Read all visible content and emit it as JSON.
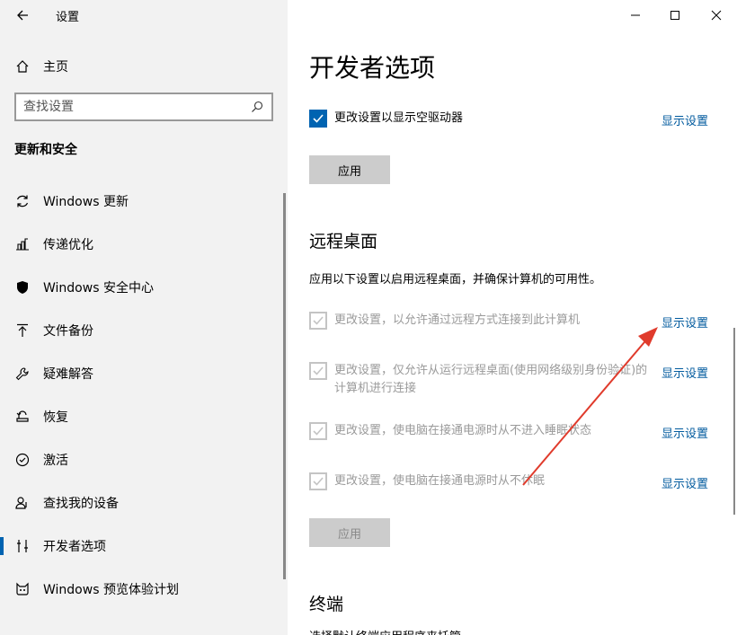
{
  "window": {
    "title": "设置",
    "back_icon": "back-arrow-icon",
    "controls": [
      "minimize-icon",
      "maximize-icon",
      "close-icon"
    ]
  },
  "sidebar": {
    "home_label": "主页",
    "search_placeholder": "查找设置",
    "section_title": "更新和安全",
    "items": [
      {
        "label": "Windows 更新",
        "icon": "refresh-icon"
      },
      {
        "label": "传递优化",
        "icon": "delivery-optimization-icon"
      },
      {
        "label": "Windows 安全中心",
        "icon": "shield-icon"
      },
      {
        "label": "文件备份",
        "icon": "upload-arrow-icon"
      },
      {
        "label": "疑难解答",
        "icon": "wrench-icon"
      },
      {
        "label": "恢复",
        "icon": "recovery-icon"
      },
      {
        "label": "激活",
        "icon": "check-circle-icon"
      },
      {
        "label": "查找我的设备",
        "icon": "person-location-icon"
      },
      {
        "label": "开发者选项",
        "icon": "developer-tools-icon",
        "active": true
      },
      {
        "label": "Windows 预览体验计划",
        "icon": "insider-cat-icon"
      }
    ]
  },
  "main": {
    "page_title": "开发者选项",
    "top_checkbox": {
      "label": "更改设置以显示空驱动器",
      "checked": true,
      "link": "显示设置"
    },
    "top_apply": "应用",
    "remote": {
      "title": "远程桌面",
      "description": "应用以下设置以启用远程桌面，并确保计算机的可用性。",
      "options": [
        {
          "label": "更改设置，以允许通过远程方式连接到此计算机",
          "link": "显示设置"
        },
        {
          "label": "更改设置，仅允许从运行远程桌面(使用网络级别身份验证)的计算机进行连接",
          "link": "显示设置"
        },
        {
          "label": "更改设置，使电脑在接通电源时从不进入睡眠状态",
          "link": "显示设置"
        },
        {
          "label": "更改设置，使电脑在接通电源时从不休眠",
          "link": "显示设置"
        }
      ],
      "apply": "应用"
    },
    "terminal_title": "终端",
    "terminal_partial": "选择默认终端应用程序来托管"
  },
  "colors": {
    "accent": "#0063b1",
    "link": "#005a9e",
    "annotation_arrow": "#e03b2c"
  }
}
